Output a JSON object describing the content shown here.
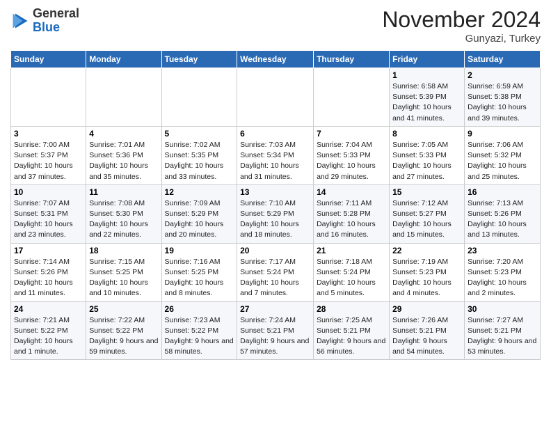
{
  "header": {
    "logo_line1": "General",
    "logo_line2": "Blue",
    "month": "November 2024",
    "location": "Gunyazi, Turkey"
  },
  "weekdays": [
    "Sunday",
    "Monday",
    "Tuesday",
    "Wednesday",
    "Thursday",
    "Friday",
    "Saturday"
  ],
  "weeks": [
    [
      {
        "day": "",
        "info": ""
      },
      {
        "day": "",
        "info": ""
      },
      {
        "day": "",
        "info": ""
      },
      {
        "day": "",
        "info": ""
      },
      {
        "day": "",
        "info": ""
      },
      {
        "day": "1",
        "info": "Sunrise: 6:58 AM\nSunset: 5:39 PM\nDaylight: 10 hours and 41 minutes."
      },
      {
        "day": "2",
        "info": "Sunrise: 6:59 AM\nSunset: 5:38 PM\nDaylight: 10 hours and 39 minutes."
      }
    ],
    [
      {
        "day": "3",
        "info": "Sunrise: 7:00 AM\nSunset: 5:37 PM\nDaylight: 10 hours and 37 minutes."
      },
      {
        "day": "4",
        "info": "Sunrise: 7:01 AM\nSunset: 5:36 PM\nDaylight: 10 hours and 35 minutes."
      },
      {
        "day": "5",
        "info": "Sunrise: 7:02 AM\nSunset: 5:35 PM\nDaylight: 10 hours and 33 minutes."
      },
      {
        "day": "6",
        "info": "Sunrise: 7:03 AM\nSunset: 5:34 PM\nDaylight: 10 hours and 31 minutes."
      },
      {
        "day": "7",
        "info": "Sunrise: 7:04 AM\nSunset: 5:33 PM\nDaylight: 10 hours and 29 minutes."
      },
      {
        "day": "8",
        "info": "Sunrise: 7:05 AM\nSunset: 5:33 PM\nDaylight: 10 hours and 27 minutes."
      },
      {
        "day": "9",
        "info": "Sunrise: 7:06 AM\nSunset: 5:32 PM\nDaylight: 10 hours and 25 minutes."
      }
    ],
    [
      {
        "day": "10",
        "info": "Sunrise: 7:07 AM\nSunset: 5:31 PM\nDaylight: 10 hours and 23 minutes."
      },
      {
        "day": "11",
        "info": "Sunrise: 7:08 AM\nSunset: 5:30 PM\nDaylight: 10 hours and 22 minutes."
      },
      {
        "day": "12",
        "info": "Sunrise: 7:09 AM\nSunset: 5:29 PM\nDaylight: 10 hours and 20 minutes."
      },
      {
        "day": "13",
        "info": "Sunrise: 7:10 AM\nSunset: 5:29 PM\nDaylight: 10 hours and 18 minutes."
      },
      {
        "day": "14",
        "info": "Sunrise: 7:11 AM\nSunset: 5:28 PM\nDaylight: 10 hours and 16 minutes."
      },
      {
        "day": "15",
        "info": "Sunrise: 7:12 AM\nSunset: 5:27 PM\nDaylight: 10 hours and 15 minutes."
      },
      {
        "day": "16",
        "info": "Sunrise: 7:13 AM\nSunset: 5:26 PM\nDaylight: 10 hours and 13 minutes."
      }
    ],
    [
      {
        "day": "17",
        "info": "Sunrise: 7:14 AM\nSunset: 5:26 PM\nDaylight: 10 hours and 11 minutes."
      },
      {
        "day": "18",
        "info": "Sunrise: 7:15 AM\nSunset: 5:25 PM\nDaylight: 10 hours and 10 minutes."
      },
      {
        "day": "19",
        "info": "Sunrise: 7:16 AM\nSunset: 5:25 PM\nDaylight: 10 hours and 8 minutes."
      },
      {
        "day": "20",
        "info": "Sunrise: 7:17 AM\nSunset: 5:24 PM\nDaylight: 10 hours and 7 minutes."
      },
      {
        "day": "21",
        "info": "Sunrise: 7:18 AM\nSunset: 5:24 PM\nDaylight: 10 hours and 5 minutes."
      },
      {
        "day": "22",
        "info": "Sunrise: 7:19 AM\nSunset: 5:23 PM\nDaylight: 10 hours and 4 minutes."
      },
      {
        "day": "23",
        "info": "Sunrise: 7:20 AM\nSunset: 5:23 PM\nDaylight: 10 hours and 2 minutes."
      }
    ],
    [
      {
        "day": "24",
        "info": "Sunrise: 7:21 AM\nSunset: 5:22 PM\nDaylight: 10 hours and 1 minute."
      },
      {
        "day": "25",
        "info": "Sunrise: 7:22 AM\nSunset: 5:22 PM\nDaylight: 9 hours and 59 minutes."
      },
      {
        "day": "26",
        "info": "Sunrise: 7:23 AM\nSunset: 5:22 PM\nDaylight: 9 hours and 58 minutes."
      },
      {
        "day": "27",
        "info": "Sunrise: 7:24 AM\nSunset: 5:21 PM\nDaylight: 9 hours and 57 minutes."
      },
      {
        "day": "28",
        "info": "Sunrise: 7:25 AM\nSunset: 5:21 PM\nDaylight: 9 hours and 56 minutes."
      },
      {
        "day": "29",
        "info": "Sunrise: 7:26 AM\nSunset: 5:21 PM\nDaylight: 9 hours and 54 minutes."
      },
      {
        "day": "30",
        "info": "Sunrise: 7:27 AM\nSunset: 5:21 PM\nDaylight: 9 hours and 53 minutes."
      }
    ]
  ]
}
